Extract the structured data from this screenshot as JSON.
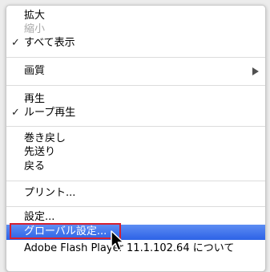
{
  "menu": {
    "zoom_in": "拡大",
    "zoom_out": "縮小",
    "show_all": "すべて表示",
    "quality": "画質",
    "play": "再生",
    "loop": "ループ再生",
    "rewind": "巻き戻し",
    "forward": "先送り",
    "back": "戻る",
    "print": "プリント...",
    "settings": "設定...",
    "global_settings": "グローバル設定...",
    "about": "Adobe Flash Player 11.1.102.64  について",
    "check_glyph": "✓"
  },
  "colors": {
    "highlight_top": "#5d8df3",
    "highlight_bottom": "#2d62e6",
    "annotation_box": "#d62030",
    "disabled_text": "#a8a8a8"
  }
}
